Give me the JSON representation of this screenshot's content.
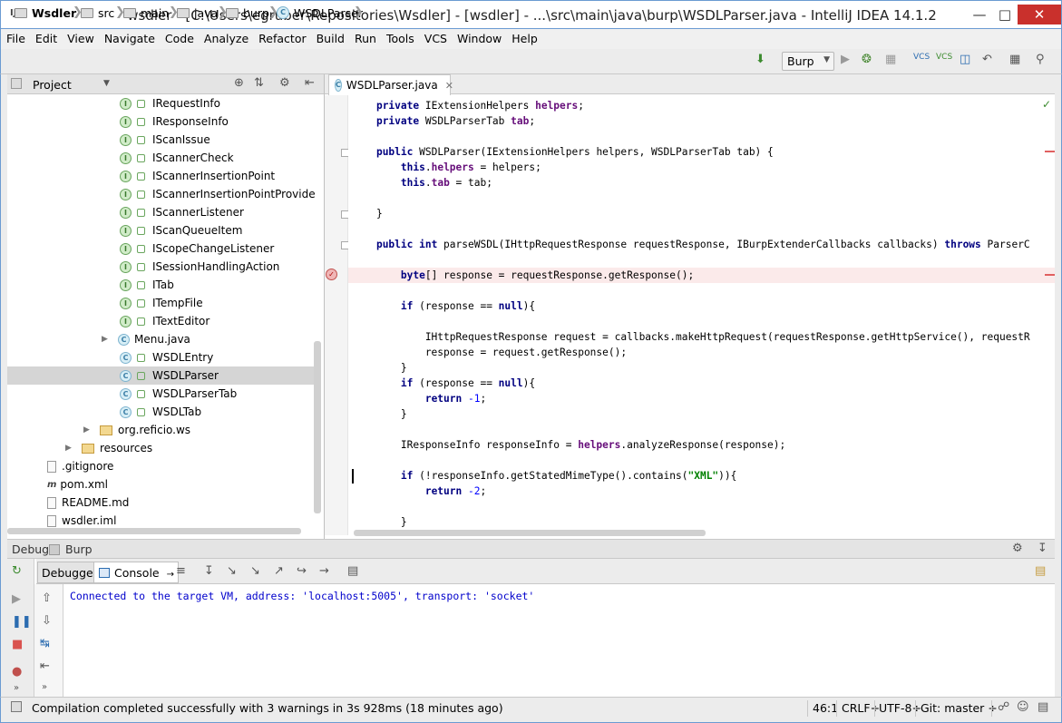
{
  "window": {
    "title": "wsdler - [C:\\Users\\egruber\\Repositories\\Wsdler] - [wsdler] - ...\\src\\main\\java\\burp\\WSDLParser.java - IntelliJ IDEA 14.1.2",
    "app_icon": "IJ"
  },
  "menu": [
    "File",
    "Edit",
    "View",
    "Navigate",
    "Code",
    "Analyze",
    "Refactor",
    "Build",
    "Run",
    "Tools",
    "VCS",
    "Window",
    "Help"
  ],
  "breadcrumb": [
    "Wsdler",
    "src",
    "main",
    "java",
    "burp",
    "WSDLParser"
  ],
  "run_config": "Burp",
  "project": {
    "label": "Project",
    "tree": [
      {
        "name": "IRequestInfo",
        "kind": "interface"
      },
      {
        "name": "IResponseInfo",
        "kind": "interface"
      },
      {
        "name": "IScanIssue",
        "kind": "interface"
      },
      {
        "name": "IScannerCheck",
        "kind": "interface"
      },
      {
        "name": "IScannerInsertionPoint",
        "kind": "interface"
      },
      {
        "name": "IScannerInsertionPointProvider",
        "kind": "interface"
      },
      {
        "name": "IScannerListener",
        "kind": "interface"
      },
      {
        "name": "IScanQueueItem",
        "kind": "interface"
      },
      {
        "name": "IScopeChangeListener",
        "kind": "interface"
      },
      {
        "name": "ISessionHandlingAction",
        "kind": "interface"
      },
      {
        "name": "ITab",
        "kind": "interface"
      },
      {
        "name": "ITempFile",
        "kind": "interface"
      },
      {
        "name": "ITextEditor",
        "kind": "interface"
      },
      {
        "name": "Menu.java",
        "kind": "classfile"
      },
      {
        "name": "WSDLEntry",
        "kind": "class"
      },
      {
        "name": "WSDLParser",
        "kind": "class",
        "selected": true
      },
      {
        "name": "WSDLParserTab",
        "kind": "class"
      },
      {
        "name": "WSDLTab",
        "kind": "class"
      },
      {
        "name": "org.reficio.ws",
        "kind": "package"
      },
      {
        "name": "resources",
        "kind": "folder"
      },
      {
        "name": ".gitignore",
        "kind": "file"
      },
      {
        "name": "pom.xml",
        "kind": "pom"
      },
      {
        "name": "README.md",
        "kind": "file"
      },
      {
        "name": "wsdler.iml",
        "kind": "file"
      }
    ]
  },
  "editor": {
    "tab": "WSDLParser.java",
    "lines": [
      "    private IExtensionHelpers helpers;",
      "    private WSDLParserTab tab;",
      "",
      "    public WSDLParser(IExtensionHelpers helpers, WSDLParserTab tab) {",
      "        this.helpers = helpers;",
      "        this.tab = tab;",
      "",
      "    }",
      "",
      "    public int parseWSDL(IHttpRequestResponse requestResponse, IBurpExtenderCallbacks callbacks) throws ParserC",
      "",
      "        byte[] response = requestResponse.getResponse();",
      "",
      "        if (response == null){",
      "",
      "            IHttpRequestResponse request = callbacks.makeHttpRequest(requestResponse.getHttpService(), requestR",
      "            response = request.getResponse();",
      "        }",
      "        if (response == null){",
      "            return -1;",
      "        }",
      "",
      "        IResponseInfo responseInfo = helpers.analyzeResponse(response);",
      "",
      "        if (!responseInfo.getStatedMimeType().contains(\"XML\")){",
      "            return -2;",
      "",
      "        }"
    ]
  },
  "debug": {
    "title": "Debug",
    "config": "Burp",
    "tabs": [
      "Debugger",
      "Console"
    ],
    "console_text": "Connected to the target VM, address: 'localhost:5005', transport: 'socket'"
  },
  "status": {
    "message": "Compilation completed successfully with 3 warnings in 3s 928ms (18 minutes ago)",
    "position": "46:1",
    "line_sep": "CRLF÷",
    "encoding": "UTF-8÷",
    "vcs": "Git: master ÷"
  }
}
